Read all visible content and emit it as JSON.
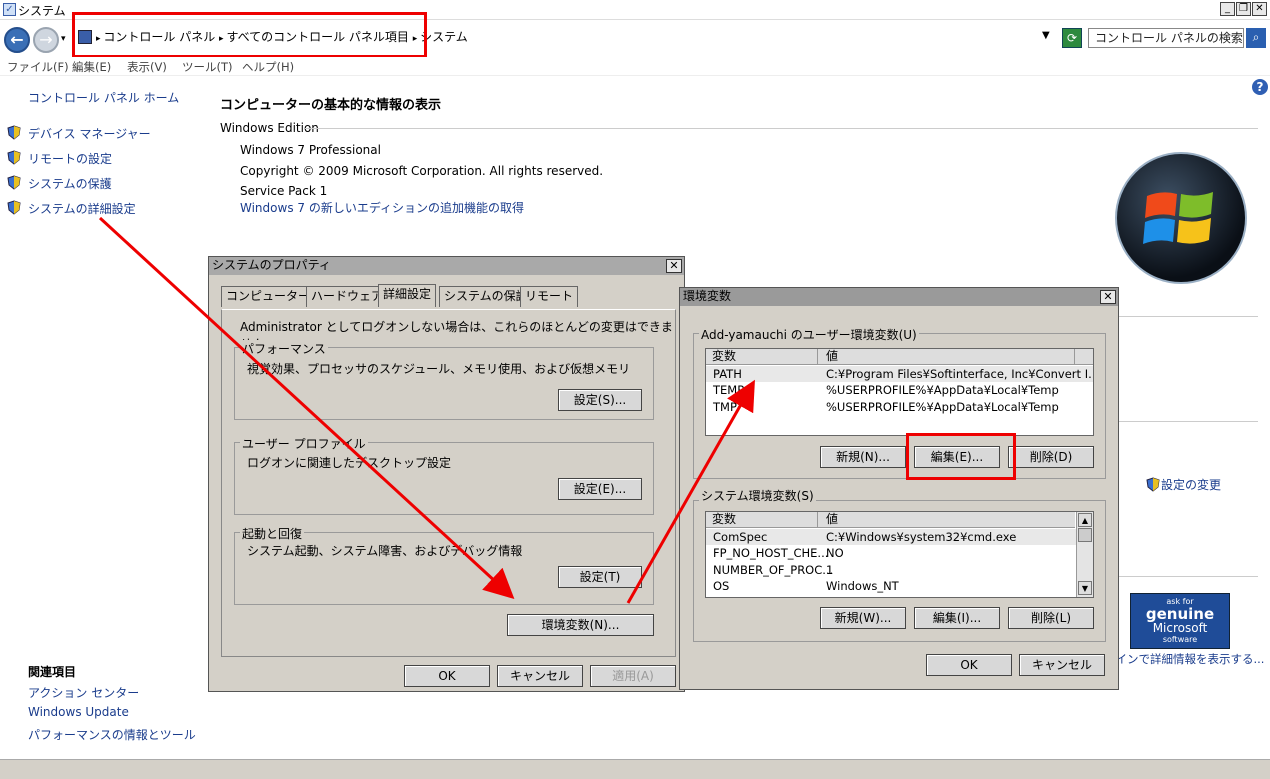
{
  "window": {
    "title": "システム"
  },
  "address": {
    "crumbs": [
      "コントロール パネル",
      "すべてのコントロール パネル項目",
      "システム"
    ],
    "search_placeholder": "コントロール パネルの検索"
  },
  "menu": [
    "ファイル(F)",
    "編集(E)",
    "表示(V)",
    "ツール(T)",
    "ヘルプ(H)"
  ],
  "sidebar": {
    "home": "コントロール パネル ホーム",
    "items": [
      "デバイス マネージャー",
      "リモートの設定",
      "システムの保護",
      "システムの詳細設定"
    ],
    "related_heading": "関連項目",
    "related": [
      "アクション センター",
      "Windows Update",
      "パフォーマンスの情報とツール"
    ]
  },
  "main": {
    "heading": "コンピューターの基本的な情報の表示",
    "edition_section": "Windows Edition",
    "edition": "Windows 7 Professional",
    "copyright": "Copyright © 2009 Microsoft Corporation.  All rights reserved.",
    "service_pack": "Service Pack 1",
    "new_features_link": "Windows 7 の新しいエディションの追加機能の取得",
    "change_settings": "設定の変更",
    "genuine_link": "ラインで詳細情報を表示する...",
    "genuine_badge": [
      "ask for",
      "genuine",
      "Microsoft",
      "software"
    ]
  },
  "sysprops": {
    "title": "システムのプロパティ",
    "tabs": [
      "コンピューター名",
      "ハードウェア",
      "詳細設定",
      "システムの保護",
      "リモート"
    ],
    "admin_note": "Administrator としてログオンしない場合は、これらのほとんどの変更はできません。",
    "perf_group": "パフォーマンス",
    "perf_desc": "視覚効果、プロセッサのスケジュール、メモリ使用、および仮想メモリ",
    "perf_btn": "設定(S)...",
    "profile_group": "ユーザー プロファイル",
    "profile_desc": "ログオンに関連したデスクトップ設定",
    "profile_btn": "設定(E)...",
    "startup_group": "起動と回復",
    "startup_desc": "システム起動、システム障害、およびデバッグ情報",
    "startup_btn": "設定(T)",
    "env_btn": "環境変数(N)...",
    "ok": "OK",
    "cancel": "キャンセル",
    "apply": "適用(A)"
  },
  "envvars": {
    "title": "環境変数",
    "user_group": "Add-yamauchi のユーザー環境変数(U)",
    "col_var": "変数",
    "col_val": "値",
    "user_rows": [
      {
        "name": "PATH",
        "value": "C:¥Program Files¥Softinterface, Inc¥Convert I..."
      },
      {
        "name": "TEMP",
        "value": "%USERPROFILE%¥AppData¥Local¥Temp"
      },
      {
        "name": "TMP",
        "value": "%USERPROFILE%¥AppData¥Local¥Temp"
      }
    ],
    "user_new": "新規(N)...",
    "user_edit": "編集(E)...",
    "user_delete": "削除(D)",
    "sys_group": "システム環境変数(S)",
    "sys_rows": [
      {
        "name": "ComSpec",
        "value": "C:¥Windows¥system32¥cmd.exe"
      },
      {
        "name": "FP_NO_HOST_CHE...",
        "value": "NO"
      },
      {
        "name": "NUMBER_OF_PROC...",
        "value": "1"
      },
      {
        "name": "OS",
        "value": "Windows_NT"
      }
    ],
    "sys_new": "新規(W)...",
    "sys_edit": "編集(I)...",
    "sys_delete": "削除(L)",
    "ok": "OK",
    "cancel": "キャンセル"
  },
  "colors": {
    "annotation": "#e00000",
    "link": "#1a3c8c",
    "dialog_bg": "#d4d0c8"
  }
}
